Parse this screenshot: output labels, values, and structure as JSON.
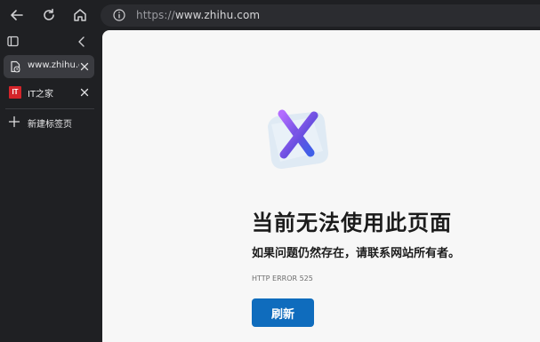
{
  "toolbar": {
    "back_icon": "arrow-left-icon",
    "refresh_icon": "refresh-icon",
    "home_icon": "home-icon"
  },
  "address_bar": {
    "protocol": "https://",
    "host": "www.zhihu.com",
    "icon": "info-icon"
  },
  "sidebar": {
    "tabs": [
      {
        "label": "www.zhihu.c",
        "icon": "loading-page-icon",
        "active": true
      },
      {
        "label": "IT之家",
        "icon": "ithome-logo-icon",
        "badge": "IT",
        "active": false
      }
    ],
    "new_tab_label": "新建标签页"
  },
  "error_page": {
    "title": "当前无法使用此页面",
    "description": "如果问题仍然存在，请联系网站所有者。",
    "code": "HTTP ERROR 525",
    "refresh_label": "刷新"
  },
  "colors": {
    "chrome_bg": "#1f2023",
    "content_bg": "#f7f7f7",
    "accent": "#0f6cbd",
    "it_badge": "#d4242a"
  }
}
